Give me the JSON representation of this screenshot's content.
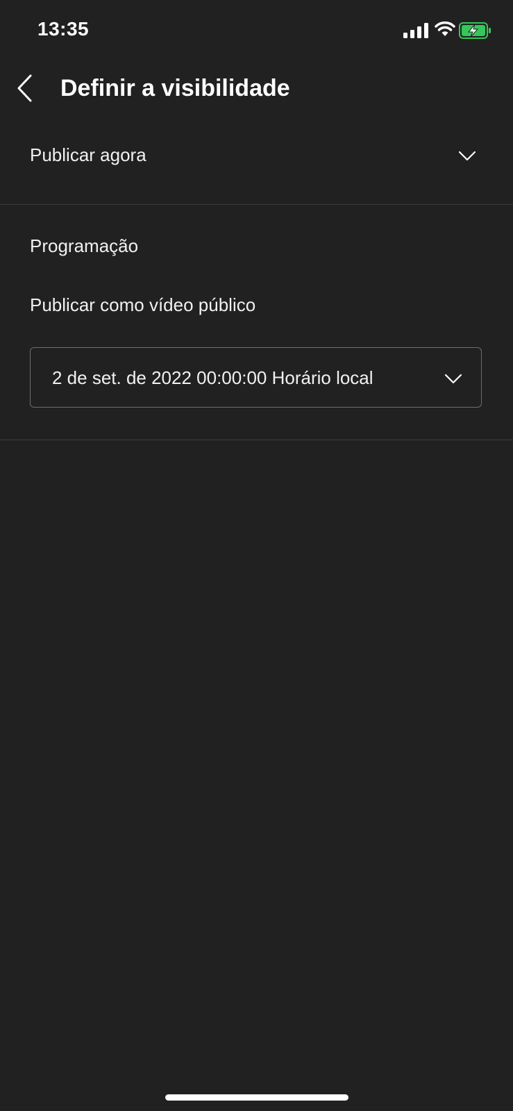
{
  "status_bar": {
    "time": "13:35",
    "icons": [
      "signal-icon",
      "wifi-icon",
      "battery-charging-icon"
    ],
    "battery_color": "#34c759"
  },
  "header": {
    "back_icon": "chevron-left-icon",
    "title": "Definir a visibilidade"
  },
  "publish_option": {
    "label": "Publicar agora",
    "icon": "chevron-down-icon"
  },
  "schedule": {
    "title": "Programação",
    "description": "Publicar como vídeo público",
    "datetime_value": "2 de set. de 2022 00:00:00 Horário local",
    "icon": "chevron-down-icon"
  },
  "theme": {
    "background": "#212121",
    "text": "#ffffff",
    "divider": "#3d3d3d",
    "field_border": "#6e6e6e"
  }
}
